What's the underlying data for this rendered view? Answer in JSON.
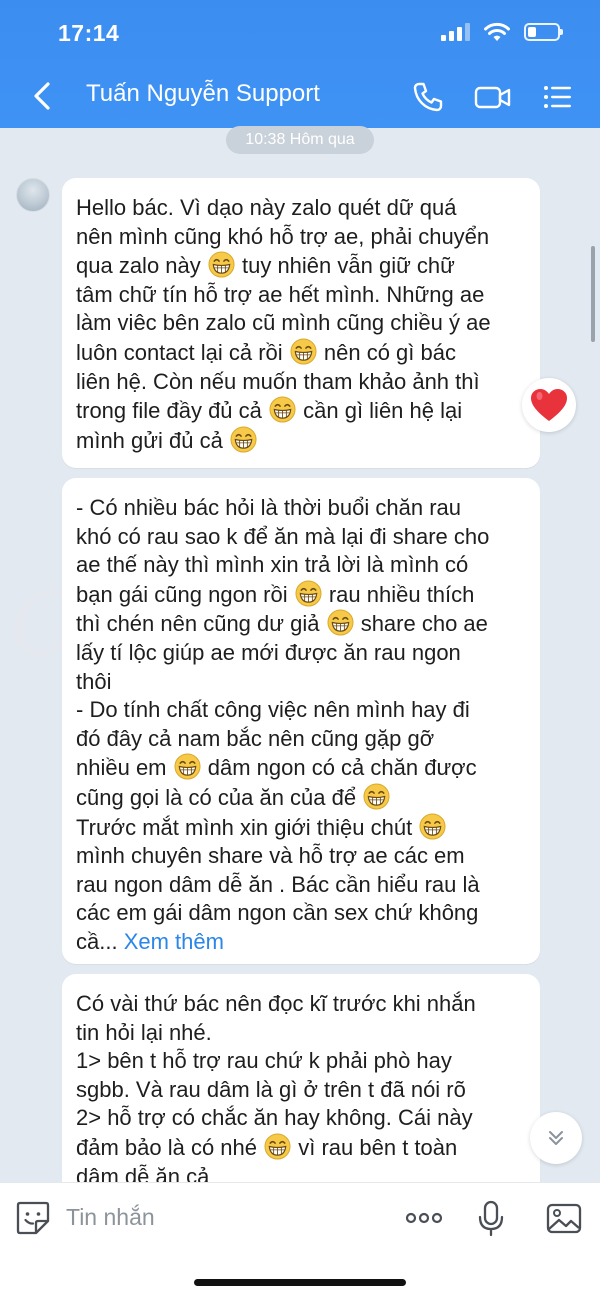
{
  "status_bar": {
    "time": "17:14",
    "battery_level": 0.3
  },
  "header": {
    "title": "Tuấn Nguyễn Support"
  },
  "timestamp": "10:38 Hôm qua",
  "messages": [
    {
      "segments": [
        "Hello bác. Vì dạo này zalo quét dữ quá\nnên mình cũng khó hỗ trợ ae, phải chuyển\nqua zalo này ",
        " tuy nhiên vẫn giữ chữ\ntâm chữ tín hỗ trợ ae hết mình. Những ae\nlàm viêc bên zalo cũ mình cũng chiều ý ae\nluôn contact lại cả rồi ",
        " nên có gì bác\nliên hệ. Còn nếu muốn tham khảo ảnh thì\ntrong file đầy đủ cả ",
        " cần gì liên hệ lại\nmình gửi đủ cả "
      ]
    },
    {
      "segments": [
        "- Có nhiều bác hỏi là thời buổi chăn rau\nkhó có rau sao k để ăn mà lại đi share cho\nae thế này thì mình xin trả lời là mình có\nbạn gái cũng ngon rồi ",
        " rau nhiều thích\nthì chén nên cũng dư giả ",
        " share cho ae\nlấy tí lộc giúp ae mới được ăn rau ngon\nthôi\n- Do tính chất công việc nên mình hay đi\nđó đây cả nam bắc nên cũng gặp gỡ\nnhiều em ",
        " dâm ngon có cả chăn được\ncũng gọi là có của ăn của để ",
        "\nTrước mắt mình xin giới thiệu chút ",
        "\nmình chuyên share và hỗ trợ ae các em\nrau ngon dâm dễ ăn . Bác cần hiểu rau là\ncác em gái dâm ngon cần sex chứ không\ncầ... "
      ],
      "see_more": "Xem thêm"
    },
    {
      "segments": [
        "Có vài thứ bác nên đọc kĩ trước khi nhắn\ntin hỏi lại nhé.\n1> bên t hỗ trợ rau chứ k phải phò hay\nsgbb. Và rau dâm là gì ở trên t đã nói rõ\n2> hỗ trợ có chắc ăn hay không. Cái này\nđảm bảo là có nhé ",
        " vì rau bên t toàn\ndâm dễ ăn cả"
      ]
    }
  ],
  "reaction": {
    "icon": "heart-icon",
    "color": "#e8323c"
  },
  "composer": {
    "placeholder": "Tin nhắn"
  },
  "colors": {
    "header": "#3f93f5",
    "background": "#e2e9f1",
    "link": "#2a86e8"
  }
}
